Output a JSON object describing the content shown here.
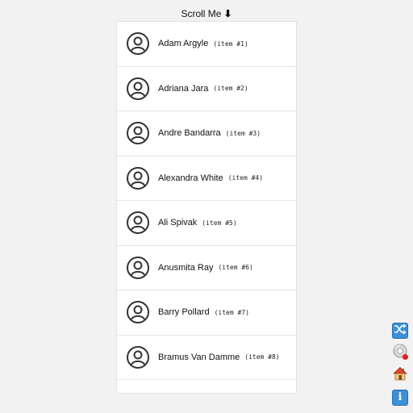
{
  "header": {
    "title": "Scroll Me",
    "arrow": "⬇"
  },
  "list": {
    "items": [
      {
        "name": "Adam Argyle",
        "tag": "(item #1)"
      },
      {
        "name": "Adriana Jara",
        "tag": "(item #2)"
      },
      {
        "name": "Andre Bandarra",
        "tag": "(item #3)"
      },
      {
        "name": "Alexandra White",
        "tag": "(item #4)"
      },
      {
        "name": "Ali Spivak",
        "tag": "(item #5)"
      },
      {
        "name": "Anusmita Ray",
        "tag": "(item #6)"
      },
      {
        "name": "Barry Pollard",
        "tag": "(item #7)"
      },
      {
        "name": "Bramus Van Damme",
        "tag": "(item #8)"
      }
    ]
  },
  "side_buttons": [
    {
      "icon": "shuffle-icon"
    },
    {
      "icon": "cd-icon"
    },
    {
      "icon": "home-icon"
    },
    {
      "icon": "info-icon",
      "label": "i"
    }
  ],
  "colors": {
    "accent": "#3d8fd6",
    "background": "#f2f2f2",
    "badge": "#e02020"
  }
}
